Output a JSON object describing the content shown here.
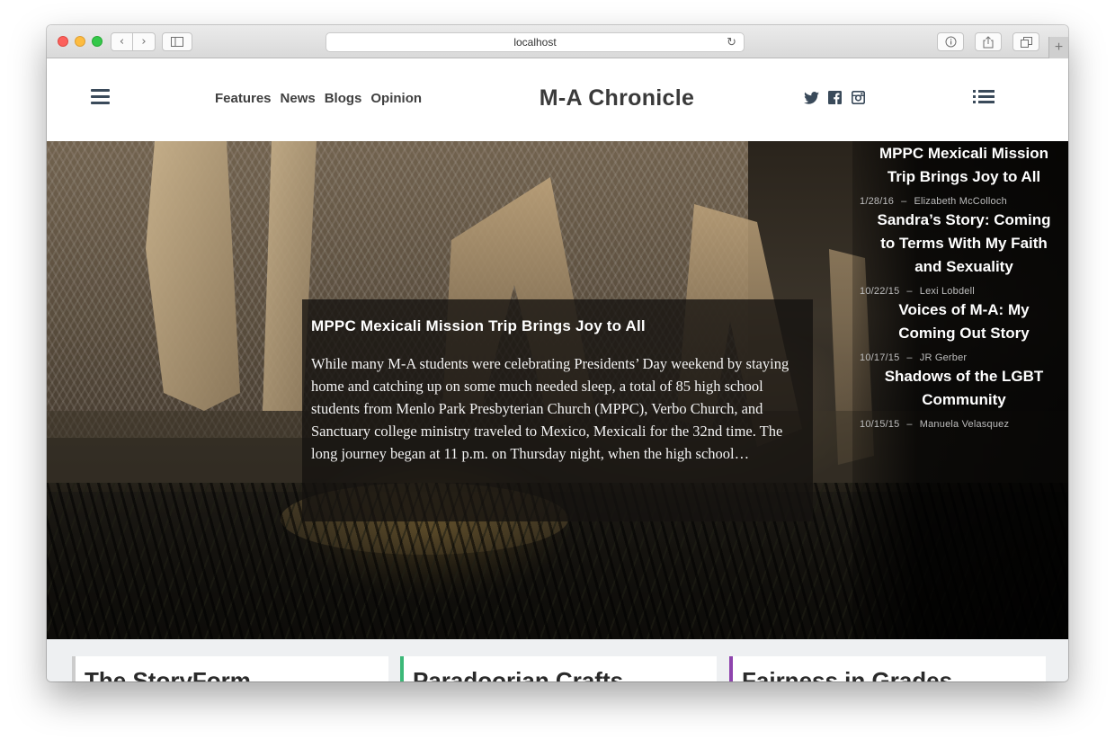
{
  "browser": {
    "url": "localhost"
  },
  "site": {
    "title": "M-A Chronicle",
    "nav": [
      "Features",
      "News",
      "Blogs",
      "Opinion"
    ]
  },
  "icons": {
    "menu": "hamburger-icon",
    "list": "list-icon",
    "social": [
      "twitter-icon",
      "facebook-icon",
      "instagram-icon"
    ]
  },
  "feature": {
    "title": "MPPC Mexicali Mission Trip Brings Joy to All",
    "excerpt": "While many M-A students were celebrating Presidents’ Day weekend by staying home and catching up on some much needed sleep, a total of 85 high school students from Menlo Park Presbyterian Church (MPPC), Verbo Church, and Sanctuary college ministry traveled to Mexico, Mexicali for the 32nd time. The long journey began at 11 p.m. on Thursday night, when the high school…"
  },
  "sidebar": {
    "items": [
      {
        "title": "MPPC Mexicali Mission Trip Brings Joy to All",
        "date": "1/28/16",
        "author": "Elizabeth McColloch"
      },
      {
        "title": "Sandra’s Story: Coming to Terms With My Faith and Sexuality",
        "date": "10/22/15",
        "author": "Lexi Lobdell"
      },
      {
        "title": "Voices of M-A: My Coming Out Story",
        "date": "10/17/15",
        "author": "JR Gerber"
      },
      {
        "title": "Shadows of the LGBT Community",
        "date": "10/15/15",
        "author": "Manuela Velasquez"
      }
    ]
  },
  "cards": [
    {
      "title": "The StoryForm",
      "accent": "#cccccc"
    },
    {
      "title": "Paradoorian Crafts",
      "accent": "#3cb878"
    },
    {
      "title": "Fairness in Grades",
      "accent": "#8e44ad"
    }
  ]
}
